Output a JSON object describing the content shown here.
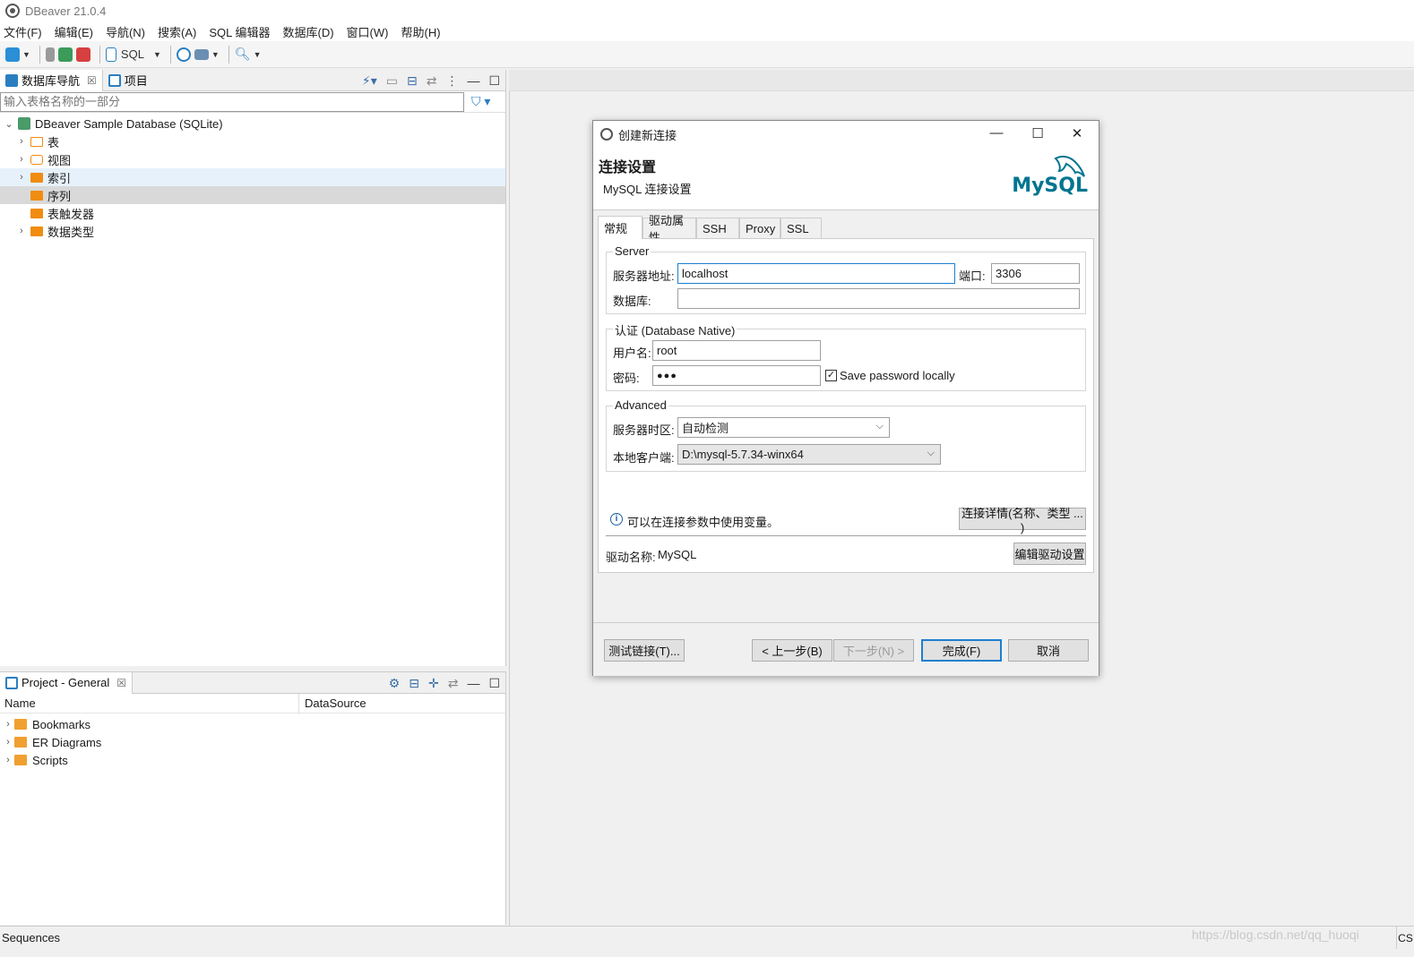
{
  "app": {
    "title": "DBeaver 21.0.4"
  },
  "menu": [
    "文件(F)",
    "编辑(E)",
    "导航(N)",
    "搜索(A)",
    "SQL 编辑器",
    "数据库(D)",
    "窗口(W)",
    "帮助(H)"
  ],
  "toolbar": {
    "sql_label": "SQL"
  },
  "nav_panel": {
    "tab_db": "数据库导航",
    "tab_project": "项目",
    "filter_placeholder": "输入表格名称的一部分",
    "root": "DBeaver Sample Database (SQLite)",
    "items": [
      {
        "label": "表"
      },
      {
        "label": "视图"
      },
      {
        "label": "索引"
      },
      {
        "label": "序列"
      },
      {
        "label": "表触发器"
      },
      {
        "label": "数据类型"
      }
    ]
  },
  "project_panel": {
    "tab": "Project - General",
    "col_name": "Name",
    "col_datasource": "DataSource",
    "items": [
      {
        "label": "Bookmarks"
      },
      {
        "label": "ER Diagrams"
      },
      {
        "label": "Scripts"
      }
    ]
  },
  "statusbar": {
    "left": "Sequences",
    "right": "CS"
  },
  "watermark": "https://blog.csdn.net/qq_huoqi",
  "dialog": {
    "title": "创建新连接",
    "header_title": "连接设置",
    "header_subtitle": "MySQL 连接设置",
    "logo_text_a": "My",
    "logo_text_b": "SQL",
    "tabs": [
      "常规",
      "驱动属性",
      "SSH",
      "Proxy",
      "SSL"
    ],
    "server_group": "Server",
    "host_label": "服务器地址:",
    "host_value": "localhost",
    "port_label": "端口:",
    "port_value": "3306",
    "db_label": "数据库:",
    "db_value": "",
    "auth_group": "认证 (Database Native)",
    "user_label": "用户名:",
    "user_value": "root",
    "pass_label": "密码:",
    "pass_value": "●●●",
    "save_password_label": "Save password locally",
    "save_password_checked": true,
    "advanced_group": "Advanced",
    "timezone_label": "服务器时区:",
    "timezone_value": "自动检测",
    "client_label": "本地客户端:",
    "client_value": "D:\\mysql-5.7.34-winx64",
    "info_text": "可以在连接参数中使用变量。",
    "details_button": "连接详情(名称、类型 ... )",
    "driver_label": "驱动名称:",
    "driver_value": "MySQL",
    "edit_driver_button": "编辑驱动设置",
    "test_button": "测试链接(T)...",
    "back_button": "< 上一步(B)",
    "next_button": "下一步(N) >",
    "finish_button": "完成(F)",
    "cancel_button": "取消"
  }
}
